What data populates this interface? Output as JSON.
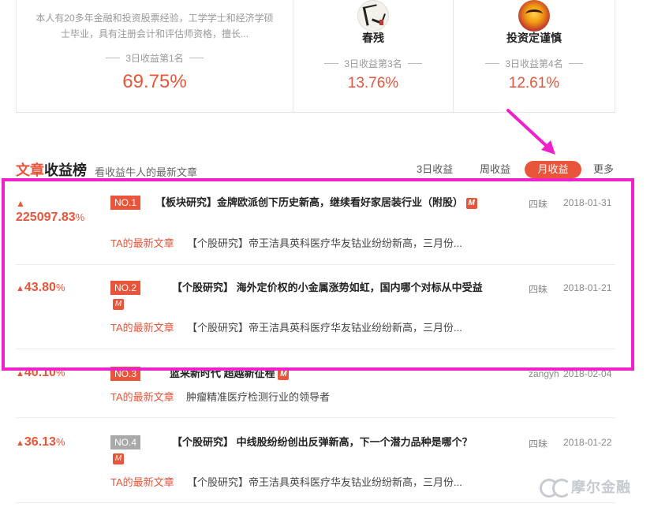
{
  "top_cards": [
    {
      "name": "",
      "desc": "本人有20多年金融和投资股票经验，工学学士和经济学硕士毕业，具有注册会计和评估师资格，擅长...",
      "rank": "3日收益第1名",
      "pct": "69.75%"
    },
    {
      "name": "春残",
      "rank": "3日收益第3名",
      "pct": "13.76%",
      "avatar_icon": "calligraphy-avatar"
    },
    {
      "name": "投资定谨慎",
      "rank": "3日收益第4名",
      "pct": "12.61%",
      "avatar_icon": "golden-bull-avatar"
    }
  ],
  "section": {
    "title_red": "文章",
    "title_dark": "收益榜",
    "subtitle": "看收益牛人的最新文章"
  },
  "tabs": {
    "three_day": "3日收益",
    "week": "周收益",
    "month": "月收益",
    "more": "更多"
  },
  "articles": [
    {
      "gain": "225097.83",
      "unit": "%",
      "no": "NO.1",
      "title": "【板块研究】金牌欧派创下历史新高，继续看好家居装行业（附股）",
      "author": "四昧",
      "date": "2018-01-31",
      "ta_label": "TA的最新文章",
      "latest": "【个股研究】帝王洁具英科医疗华友钴业纷纷新高，三月份..."
    },
    {
      "gain": "43.80",
      "unit": "%",
      "no": "NO.2",
      "title": "【个股研究】 海外定价权的小金属涨势如虹，国内哪个对标从中受益",
      "author": "四昧",
      "date": "2018-01-21",
      "ta_label": "TA的最新文章",
      "latest": "【个股研究】帝王洁具英科医疗华友钴业纷纷新高，三月份..."
    },
    {
      "gain": "40.10",
      "unit": "%",
      "no": "NO.3",
      "title": "蓝来新时代 超越新征程",
      "author": "zangyh",
      "date": "2018-02-04",
      "ta_label": "TA的最新文章",
      "latest": "肿瘤精准医疗检测行业的领导者"
    },
    {
      "gain": "36.13",
      "unit": "%",
      "no": "NO.4",
      "title": "【个股研究】 中线股纷纷创出反弹新高，下一个潜力品种是哪个？",
      "author": "四昧",
      "date": "2018-01-22",
      "ta_label": "TA的最新文章",
      "latest": "【个股研究】帝王洁具英科医疗华友钴业纷纷新高，三月份..."
    }
  ],
  "m_icon_glyph": "M",
  "watermark": "摩尔金融",
  "colors": {
    "accent": "#e8553a",
    "highlight": "#ee22c8",
    "badge_gray": "#a9a9a9"
  }
}
